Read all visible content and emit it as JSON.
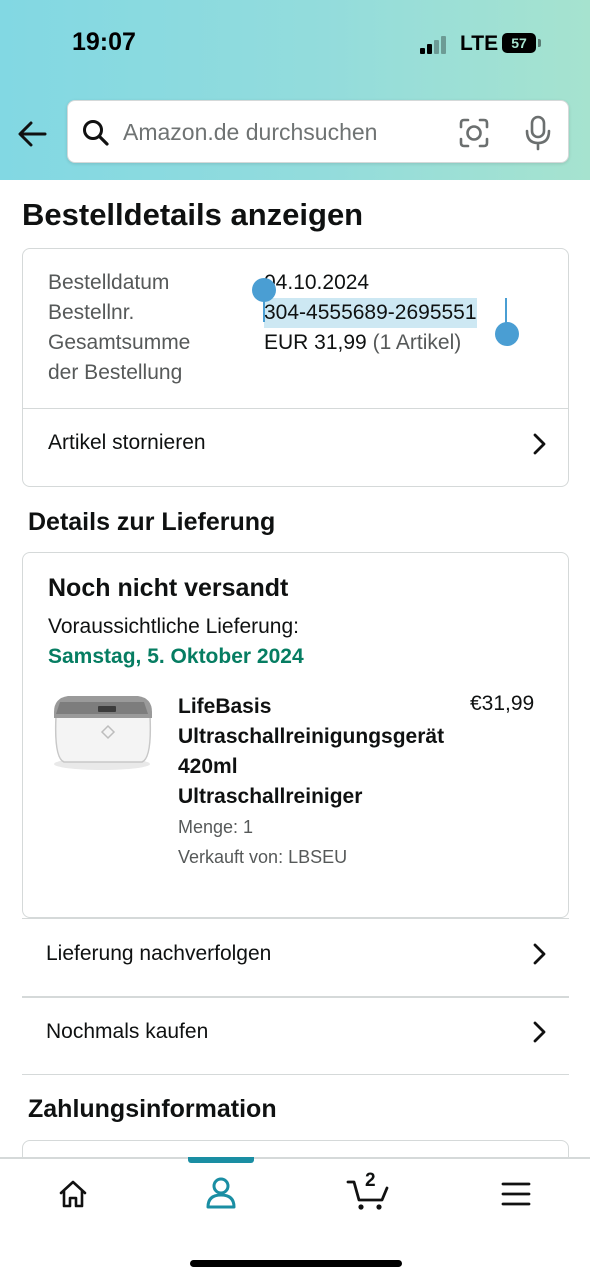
{
  "status_bar": {
    "time": "19:07",
    "network": "LTE",
    "battery": "57"
  },
  "search": {
    "placeholder": "Amazon.de durchsuchen"
  },
  "page_title": "Bestelldetails anzeigen",
  "order_summary": {
    "date_label": "Bestelldatum",
    "date_value": "04.10.2024",
    "number_label": "Bestellnr.",
    "number_value": "304-4555689-2695551",
    "total_label_line1": "Gesamtsumme",
    "total_label_line2": "der Bestellung",
    "total_value": "EUR 31,99",
    "total_items": "(1 Artikel)",
    "cancel_label": "Artikel stornieren"
  },
  "delivery": {
    "heading": "Details zur Lieferung",
    "status": "Noch nicht versandt",
    "expected_label": "Voraussichtliche Lieferung:",
    "expected_date": "Samstag, 5. Oktober 2024",
    "product": {
      "name_lines": [
        "LifeBasis",
        "Ultraschallreinigungsgerät",
        "420ml",
        "Ultraschallreiniger"
      ],
      "price": "€31,99",
      "quantity": "Menge: 1",
      "seller": "Verkauft von: LBSEU"
    },
    "track_label": "Lieferung nachverfolgen",
    "buy_again_label": "Nochmals kaufen"
  },
  "payment": {
    "heading": "Zahlungsinformation"
  },
  "bottom_nav": {
    "items": [
      "home",
      "account",
      "cart",
      "menu"
    ],
    "active": "account",
    "cart_count": "2"
  },
  "colors": {
    "accent": "#1a8ea3",
    "delivery_green": "#067d62",
    "selection": "#cde8f3",
    "handle": "#4a9ed3"
  },
  "icons": [
    "back-arrow-icon",
    "search-icon",
    "camera-lens-icon",
    "microphone-icon",
    "chevron-right-icon",
    "home-icon",
    "user-icon",
    "cart-icon",
    "hamburger-menu-icon"
  ]
}
